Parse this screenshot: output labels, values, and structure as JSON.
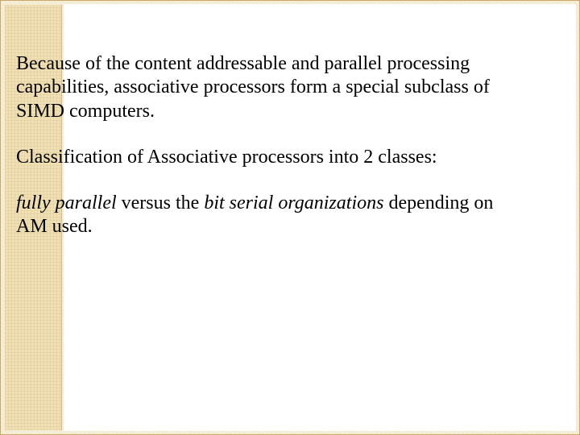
{
  "slide": {
    "para1": "Because of the content addressable and parallel processing capabilities, associative processors form a special subclass of SIMD computers.",
    "para2": "Classification of Associative processors into 2 classes:",
    "para3_italic1": "fully parallel",
    "para3_mid": " versus the ",
    "para3_italic2": "bit serial organizations",
    "para3_tail": " depending on AM used."
  }
}
